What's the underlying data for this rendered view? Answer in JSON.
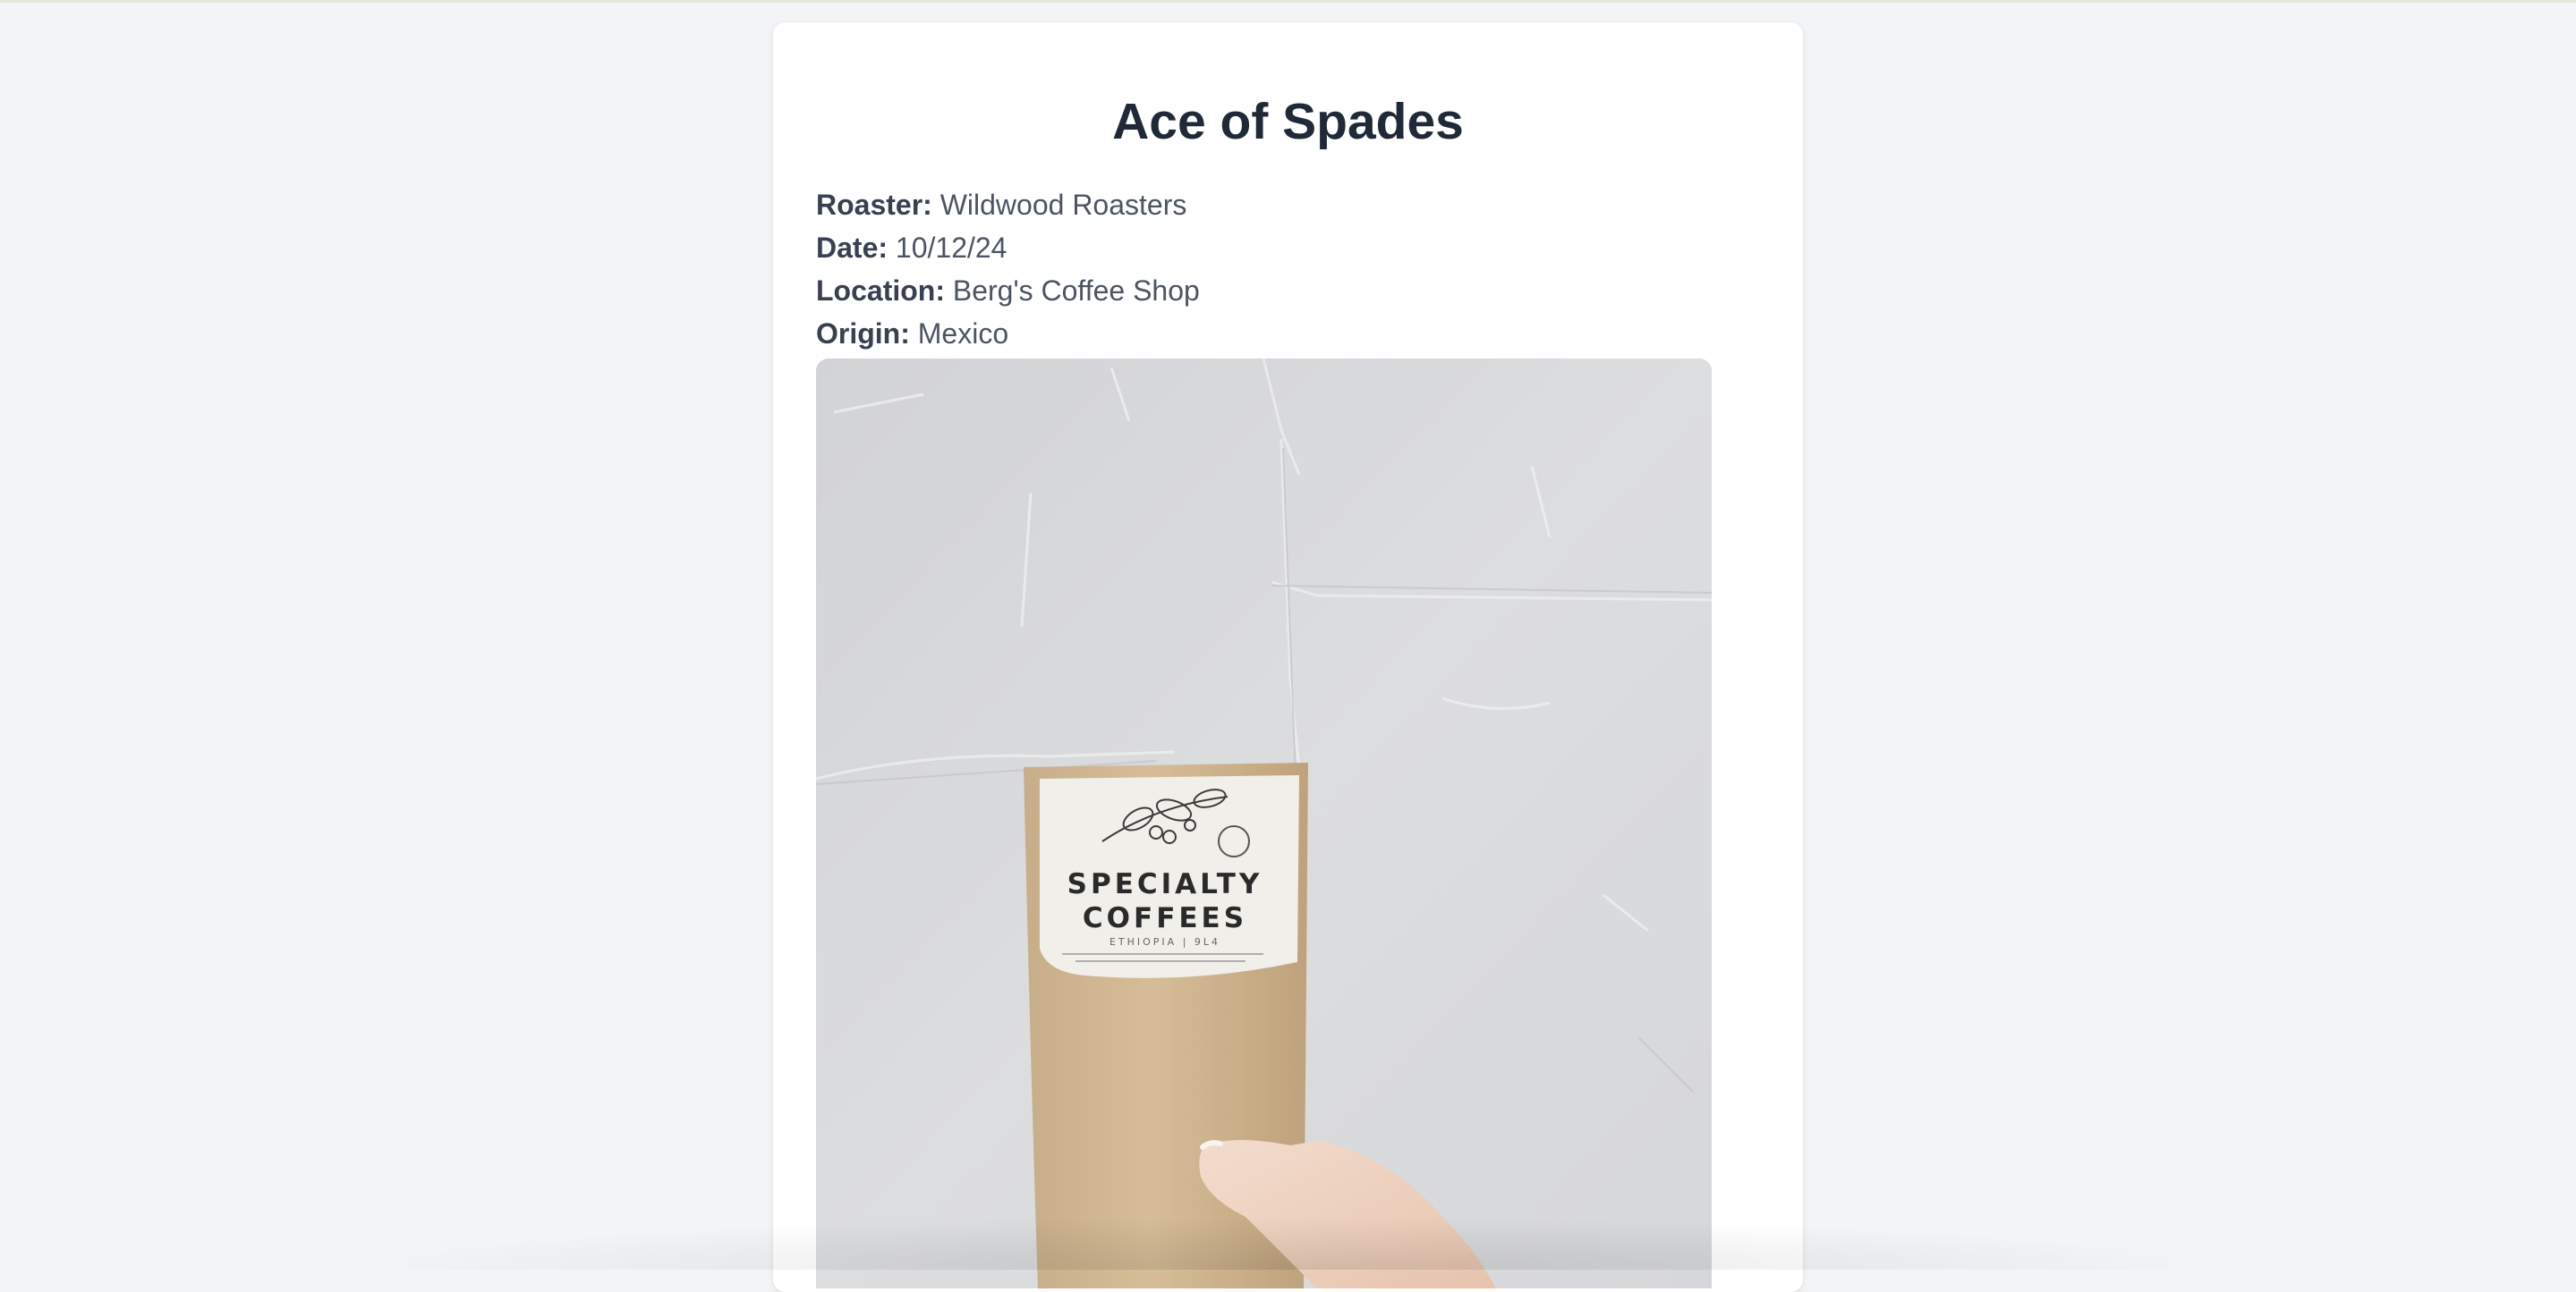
{
  "coffee": {
    "name": "Ace of Spades",
    "details": [
      {
        "label": "Roaster:",
        "value": "Wildwood Roasters"
      },
      {
        "label": "Date:",
        "value": "10/12/24"
      },
      {
        "label": "Location:",
        "value": "Berg's Coffee Shop"
      },
      {
        "label": "Origin:",
        "value": "Mexico"
      }
    ]
  },
  "photo": {
    "subject": "hand-holding-coffee-bag",
    "bag_label_line1": "SPECIALTY",
    "bag_label_line2": "COFFEES",
    "bag_label_line3": "ETHIOPIA | 9L4"
  },
  "colors": {
    "page_background": "#f3f4f6",
    "card_background": "#ffffff",
    "title_text": "#1f2937",
    "body_text": "#4b5563"
  }
}
